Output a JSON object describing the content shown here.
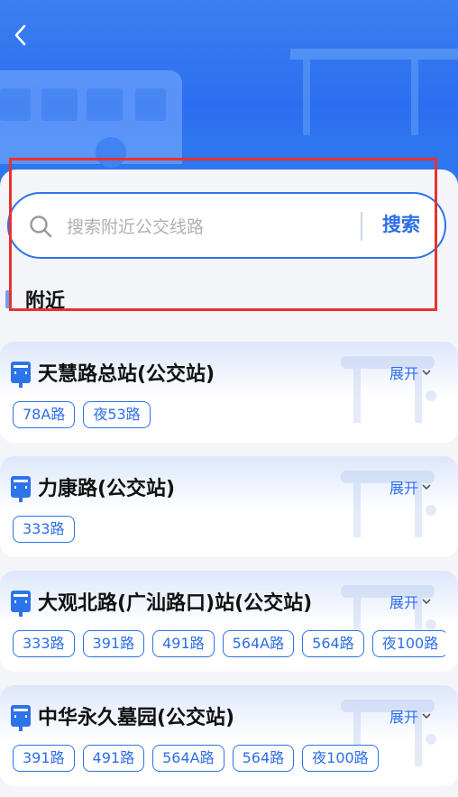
{
  "search": {
    "placeholder": "搜索附近公交线路",
    "button_label": "搜索"
  },
  "section": {
    "title": "附近"
  },
  "stops": [
    {
      "name": "天慧路总站(公交站)",
      "expand_label": "展开",
      "routes": [
        "78A路",
        "夜53路"
      ]
    },
    {
      "name": "力康路(公交站)",
      "expand_label": "展开",
      "routes": [
        "333路"
      ]
    },
    {
      "name": "大观北路(广汕路口)站(公交站)",
      "expand_label": "展开",
      "routes": [
        "333路",
        "391路",
        "491路",
        "564A路",
        "564路",
        "夜100路"
      ]
    },
    {
      "name": "中华永久墓园(公交站)",
      "expand_label": "展开",
      "routes": [
        "391路",
        "491路",
        "564A路",
        "564路",
        "夜100路"
      ]
    }
  ],
  "colors": {
    "accent": "#2c6ee8",
    "hero": "#2f72ee",
    "highlight": "#e8322e"
  }
}
